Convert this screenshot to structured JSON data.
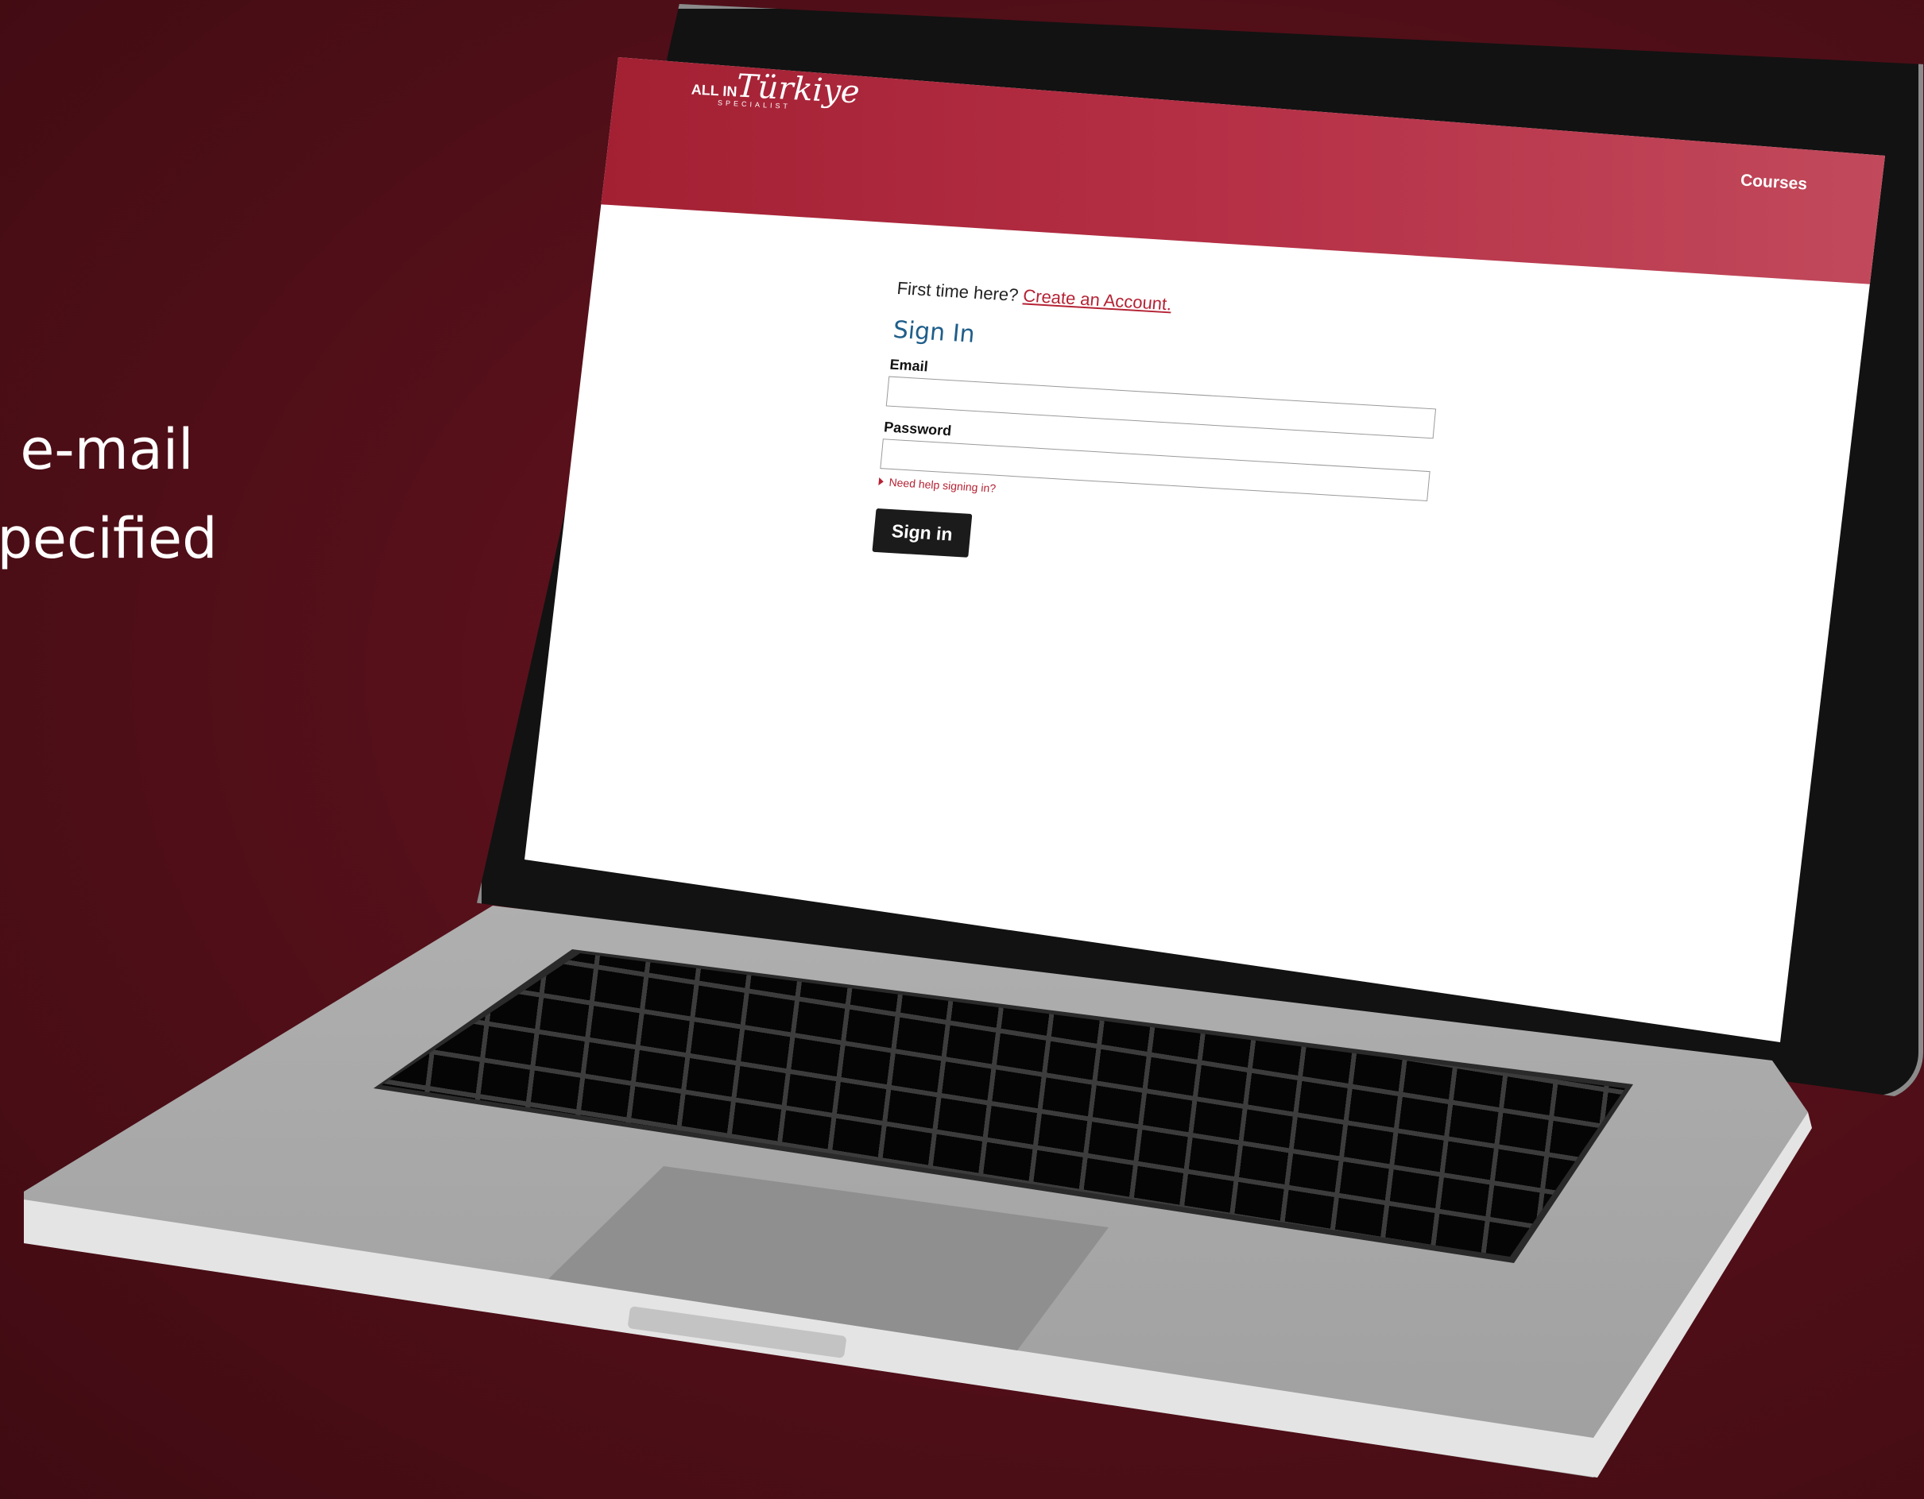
{
  "slide": {
    "text_lines": [
      "e e-mail",
      "specified"
    ]
  },
  "site": {
    "logo_all_in": "ALL IN",
    "logo_script": "Türkiye",
    "logo_specialist": "SPECIALIST",
    "nav_courses": "Courses",
    "brand_color": "#a01e30"
  },
  "login": {
    "first_time_text": "First time here?",
    "create_account_link": "Create an Account.",
    "title": "Sign In",
    "email_label": "Email",
    "email_value": "",
    "password_label": "Password",
    "password_value": "",
    "help_link": "Need help signing in?",
    "signin_button": "Sign in"
  },
  "icons": [
    "triangle-right-icon"
  ]
}
